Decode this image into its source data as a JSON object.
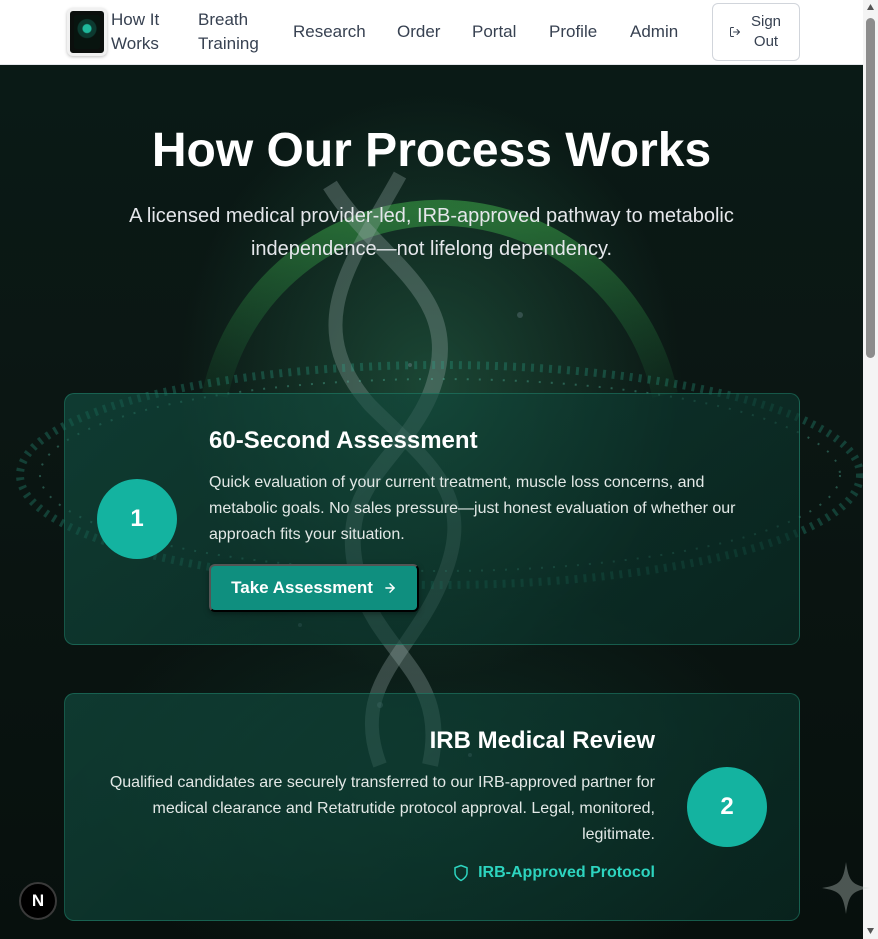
{
  "nav": {
    "links": [
      {
        "label": "How It Works"
      },
      {
        "label": "Breath Training"
      },
      {
        "label": "Research"
      },
      {
        "label": "Order"
      },
      {
        "label": "Portal"
      },
      {
        "label": "Profile"
      },
      {
        "label": "Admin"
      }
    ],
    "sign_out_label": "Sign Out"
  },
  "hero": {
    "title": "How Our Process Works",
    "subtitle": "A licensed medical provider-led, IRB-approved pathway to metabolic independence—not lifelong dependency."
  },
  "steps": [
    {
      "number": "1",
      "title": "60-Second Assessment",
      "text": "Quick evaluation of your current treatment, muscle loss concerns, and metabolic goals. No sales pressure—just honest evaluation of whether our approach fits your situation.",
      "button_label": "Take Assessment"
    },
    {
      "number": "2",
      "title": "IRB Medical Review",
      "text": "Qualified candidates are securely transferred to our IRB-approved partner for medical clearance and Retatrutide protocol approval. Legal, monitored, legitimate.",
      "badge_label": "IRB-Approved Protocol"
    }
  ],
  "dev_badge": "N",
  "colors": {
    "accent": "#14b3a0",
    "button": "#0f8f7f",
    "badge_text": "#2dd4bf",
    "background": "#07100d"
  },
  "icons": {
    "sign_out": "log-out-icon",
    "cta_arrow": "arrow-right-icon",
    "badge": "shield-icon"
  }
}
